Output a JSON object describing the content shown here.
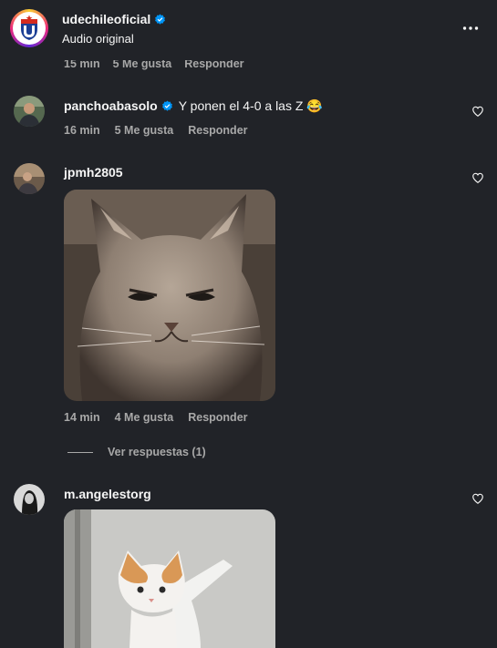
{
  "header": {
    "username": "udechileoficial",
    "subtitle": "Audio original"
  },
  "cut_row": {
    "time": "15 min",
    "likes": "5 Me gusta",
    "reply": "Responder"
  },
  "comments": [
    {
      "username": "panchoabasolo",
      "verified": true,
      "text": "Y ponen el 4-0 a las Z 😂",
      "time": "16 min",
      "likes": "5 Me gusta",
      "reply": "Responder"
    },
    {
      "username": "jpmh2805",
      "gif": "angry-cat-gif",
      "time": "14 min",
      "likes": "4 Me gusta",
      "reply": "Responder",
      "view_replies": "Ver respuestas (1)"
    },
    {
      "username": "m.angelestorg",
      "gif": "waving-kitten-gif"
    }
  ],
  "colors": {
    "background": "#212328",
    "secondary_text": "#a8a8a8",
    "verified": "#0095f6"
  }
}
